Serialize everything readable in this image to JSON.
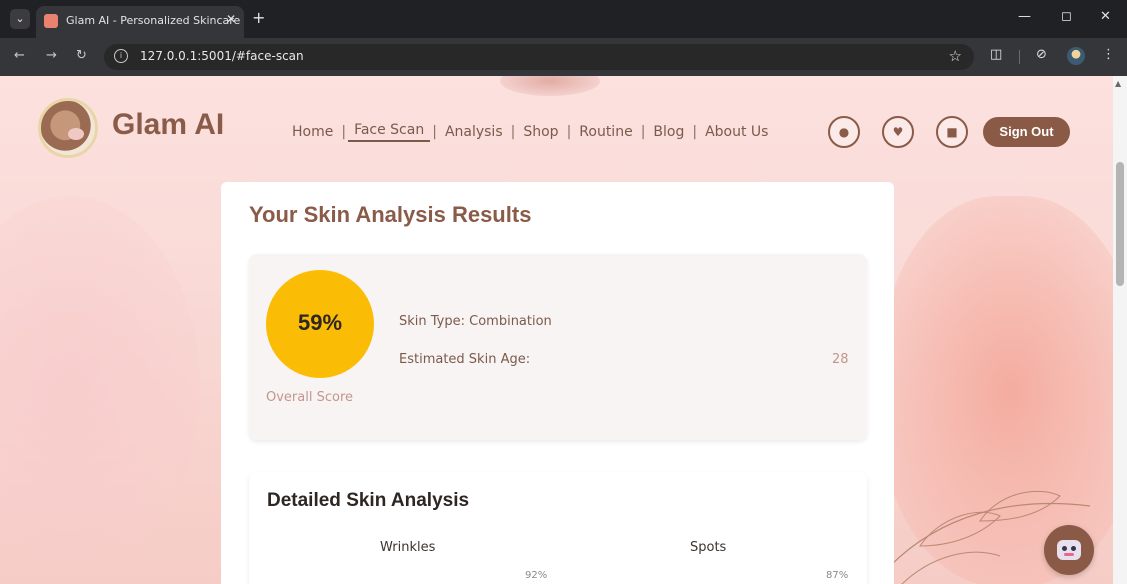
{
  "browser": {
    "tab_title": "Glam AI - Personalized Skincare",
    "tab_close": "✕",
    "new_tab": "+",
    "url": "127.0.0.1:5001/#face-scan",
    "window_controls": {
      "minimize": "—",
      "maximize": "◻",
      "close": "✕"
    }
  },
  "site": {
    "brand": "Glam AI",
    "nav": [
      {
        "label": "Home"
      },
      {
        "label": "Face Scan",
        "active": true
      },
      {
        "label": "Analysis"
      },
      {
        "label": "Shop"
      },
      {
        "label": "Routine"
      },
      {
        "label": "Blog"
      },
      {
        "label": "About Us"
      }
    ],
    "nav_separator": "|",
    "header_icons": [
      "user-icon",
      "heart-icon",
      "bag-icon"
    ],
    "sign_out_label": "Sign Out"
  },
  "results": {
    "title": "Your Skin Analysis Results",
    "overall_score": "59%",
    "overall_score_label": "Overall Score",
    "skin_type": "Skin Type: Combination",
    "skin_age_label": "Estimated Skin Age:",
    "skin_age_value": "28"
  },
  "detail": {
    "title": "Detailed Skin Analysis",
    "metrics": [
      {
        "label": "Wrinkles",
        "value": "92%"
      },
      {
        "label": "Spots",
        "value": "87%"
      }
    ]
  },
  "colors": {
    "brand": "#8a5b48",
    "score_circle": "#fbbc05",
    "sign_out_bg": "#8a5a47"
  }
}
